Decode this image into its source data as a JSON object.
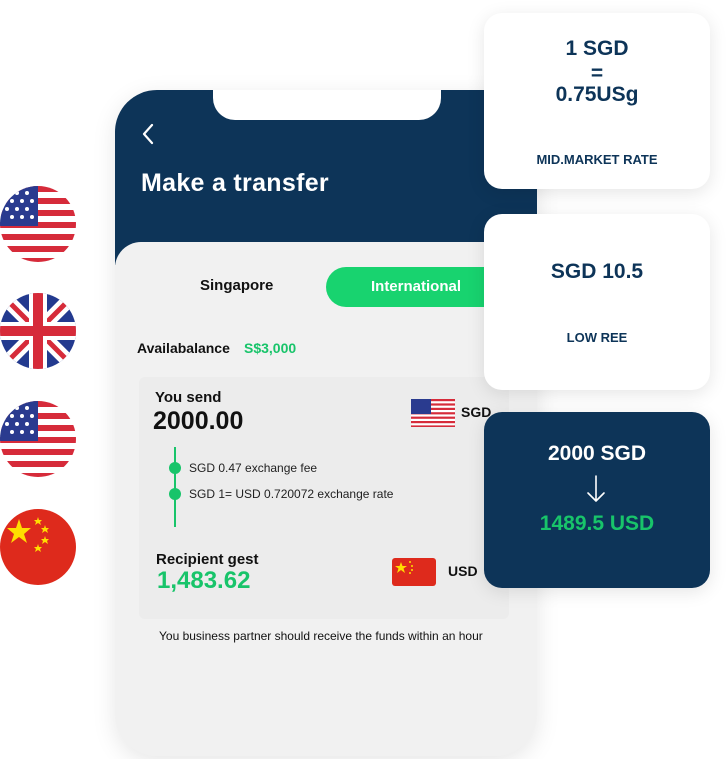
{
  "flags": [
    {
      "icon": "usa-flag-icon"
    },
    {
      "icon": "uk-flag-icon"
    },
    {
      "icon": "usa-flag-icon"
    },
    {
      "icon": "china-flag-icon"
    }
  ],
  "screen": {
    "title": "Make a transfer",
    "back_icon": "chevron-left-icon",
    "tabs": {
      "local": "Singapore",
      "international": "International"
    },
    "balance": {
      "label": "Availabalance",
      "value": "S$3,000"
    },
    "send": {
      "label": "You send",
      "amount": "2000.00",
      "currency": "SGD",
      "flag_icon": "usa-flag-icon"
    },
    "timeline": {
      "fee": "SGD 0.47 exchange fee",
      "rate": "SGD 1= USD 0.720072 exchange rate"
    },
    "recipient": {
      "label": "Recipient gest",
      "amount": "1,483.62",
      "currency": "USD",
      "flag_icon": "china-flag-icon"
    },
    "note": "You business partner should receive the funds within an hour"
  },
  "cards": {
    "rate": {
      "top": "1 SGD",
      "equals": "=",
      "bottom": "0.75USg",
      "caption": "MID.MARKET RATE"
    },
    "fee": {
      "amount": "SGD 10.5",
      "caption": "LOW REE"
    },
    "convert": {
      "from": "2000 SGD",
      "to": "1489.5 USD",
      "arrow_icon": "arrow-down-icon"
    }
  },
  "colors": {
    "navy": "#0d3458",
    "green": "#18c46a",
    "bright_green": "#18d36f"
  }
}
